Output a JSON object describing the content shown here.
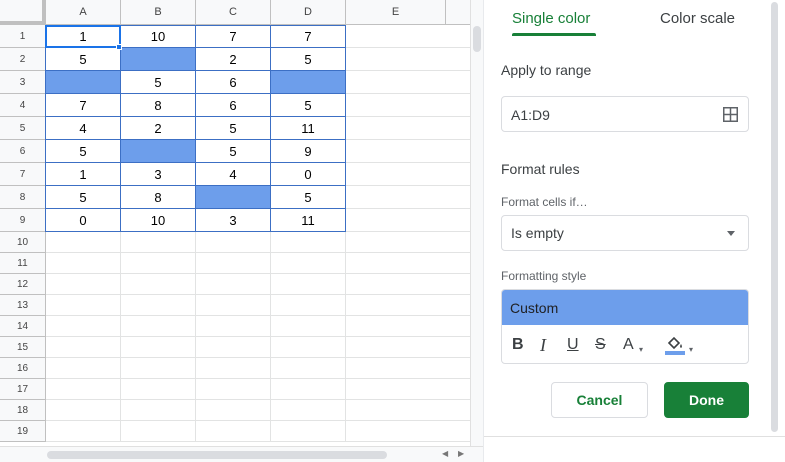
{
  "sheet": {
    "columns": [
      "A",
      "B",
      "C",
      "D",
      "E"
    ],
    "rows": [
      "1",
      "2",
      "3",
      "4",
      "5",
      "6",
      "7",
      "8",
      "9",
      "10",
      "11",
      "12",
      "13",
      "14",
      "15",
      "16",
      "17",
      "18",
      "19"
    ],
    "cells": [
      [
        "1",
        "10",
        "7",
        "7"
      ],
      [
        "5",
        "",
        "2",
        "5"
      ],
      [
        "",
        "5",
        "6",
        ""
      ],
      [
        "7",
        "8",
        "6",
        "5"
      ],
      [
        "4",
        "2",
        "5",
        "11"
      ],
      [
        "5",
        "",
        "5",
        "9"
      ],
      [
        "1",
        "3",
        "4",
        "0"
      ],
      [
        "5",
        "8",
        "",
        "5"
      ],
      [
        "0",
        "10",
        "3",
        "11"
      ]
    ],
    "highlight_color": "#6d9eeb",
    "selection_color": "#1a73e8"
  },
  "panel": {
    "tabs": [
      "Single color",
      "Color scale"
    ],
    "active_tab": "Single color",
    "apply_to_range_label": "Apply to range",
    "range_value": "A1:D9",
    "format_rules_label": "Format rules",
    "format_cells_if_label": "Format cells if…",
    "condition_value": "Is empty",
    "formatting_style_label": "Formatting style",
    "style_preview_text": "Custom",
    "style_fill_color": "#6d9eeb",
    "toolbar": {
      "bold": "B",
      "italic": "I",
      "underline": "U",
      "strikethrough": "S",
      "text_color": "A"
    },
    "cancel_label": "Cancel",
    "done_label": "Done",
    "accent_color": "#188038"
  }
}
